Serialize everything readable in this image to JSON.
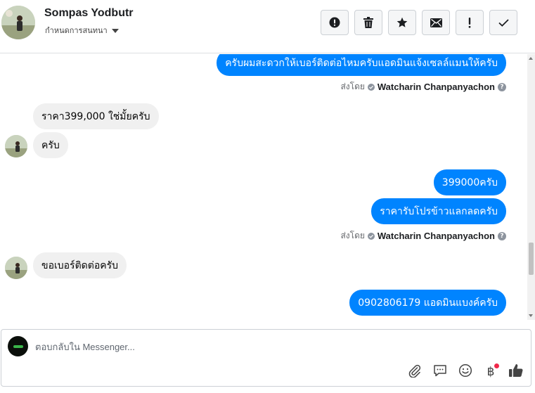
{
  "header": {
    "contact_name": "Sompas Yodbutr",
    "convo_label": "กำหนดการสนทนา",
    "actions": [
      {
        "name": "report-spam",
        "label": "Report"
      },
      {
        "name": "delete",
        "label": "Delete"
      },
      {
        "name": "star",
        "label": "Star"
      },
      {
        "name": "mark-unread",
        "label": "Mark as unread"
      },
      {
        "name": "follow-up",
        "label": "Follow up"
      },
      {
        "name": "mark-done",
        "label": "Done"
      }
    ]
  },
  "messages": [
    {
      "dir": "out",
      "text": "ครับผมสะดวกให้เบอร์ติดต่อไหมครับแอดมินแจ้งเซลล์แมนให้ครับ"
    },
    {
      "dir": "sent_by",
      "prefix": "ส่งโดย",
      "who": "Watcharin Chanpanyachon"
    },
    {
      "dir": "in",
      "text": "ราคา399,000 ใช่มั้ยครับ"
    },
    {
      "dir": "in",
      "text": "ครับ"
    },
    {
      "dir": "out",
      "text": "399000ครับ"
    },
    {
      "dir": "out",
      "text": "ราคารับโปรข้าวแลกลดครับ"
    },
    {
      "dir": "sent_by",
      "prefix": "ส่งโดย",
      "who": "Watcharin Chanpanyachon"
    },
    {
      "dir": "in",
      "text": "ขอเบอร์ติดต่อครับ"
    },
    {
      "dir": "out",
      "text": "0902806179 แอดมินแบงค์ครับ"
    }
  ],
  "composer": {
    "placeholder": "ตอบกลับใน Messenger...",
    "value": "",
    "tools": [
      "paperclip-icon",
      "saved-reply-icon",
      "emoji-icon",
      "baht-payment-icon",
      "like-icon"
    ],
    "baht_symbol": "฿"
  },
  "colors": {
    "outgoing_bubble": "#0084ff",
    "incoming_bubble": "#f0f0f0",
    "notification_dot": "#f02849"
  }
}
